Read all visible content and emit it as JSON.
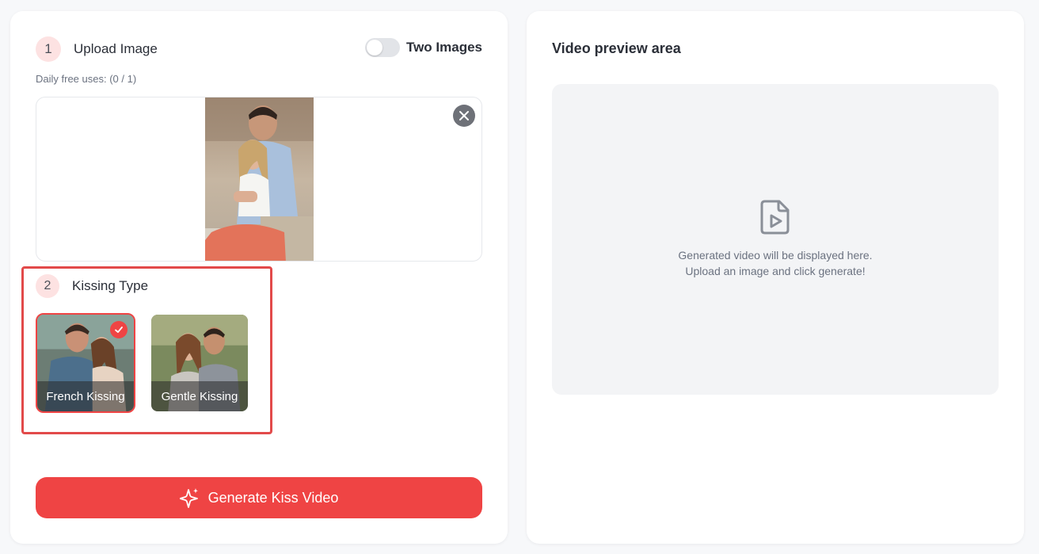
{
  "upload": {
    "step_number": "1",
    "title": "Upload Image",
    "toggle_label": "Two Images",
    "toggle_on": false,
    "free_uses": "Daily free uses: (0 / 1)"
  },
  "kissing": {
    "step_number": "2",
    "title": "Kissing Type",
    "options": [
      {
        "label": "French Kissing",
        "selected": true
      },
      {
        "label": "Gentle Kissing",
        "selected": false
      }
    ]
  },
  "generate": {
    "label": "Generate Kiss Video",
    "icon": "sparkle-icon"
  },
  "preview": {
    "title": "Video preview area",
    "line1": "Generated video will be displayed here.",
    "line2": "Upload an image and click generate!",
    "icon": "video-file-icon"
  },
  "colors": {
    "accent": "#ef4444",
    "badge_bg": "#fde2e2",
    "highlight": "#e24a4a",
    "preview_bg": "#f3f4f6"
  }
}
